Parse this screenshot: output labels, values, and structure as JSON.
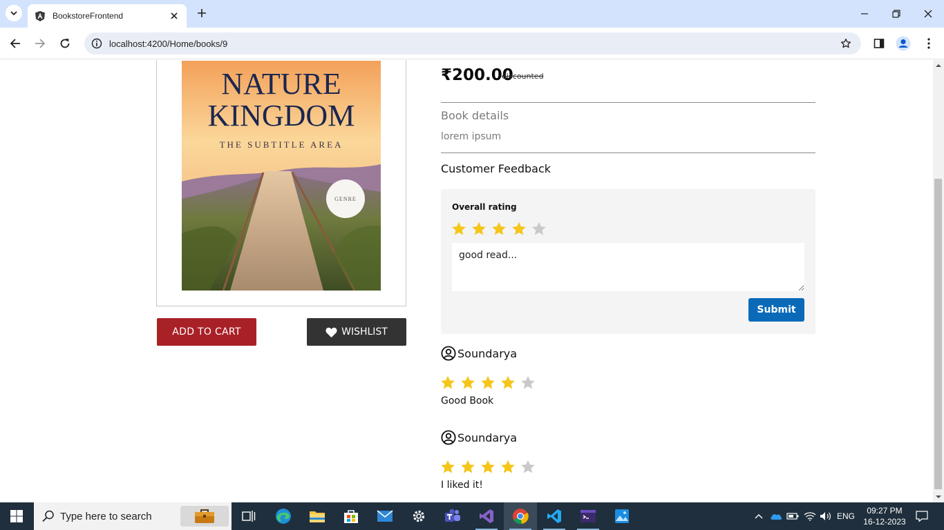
{
  "browser": {
    "tab_title": "BookstoreFrontend",
    "url": "localhost:4200/Home/books/9"
  },
  "book": {
    "cover": {
      "title_line1": "NATURE",
      "title_line2": "KINGDOM",
      "subtitle": "THE SUBTITLE AREA",
      "badge": "GENRE"
    },
    "price": "₹200.00",
    "price_note": "discounted",
    "details_heading": "Book details",
    "details_text": "lorem ipsum",
    "add_to_cart_label": "ADD TO CART",
    "wishlist_label": "WISHLIST"
  },
  "feedback": {
    "heading": "Customer Feedback",
    "overall_rating_label": "Overall rating",
    "rating": 4,
    "max_rating": 5,
    "comment_value": "good read...",
    "submit_label": "Submit"
  },
  "reviews": [
    {
      "user": "Soundarya",
      "rating": 4,
      "text": "Good Book"
    },
    {
      "user": "Soundarya",
      "rating": 4,
      "text": "I liked it!"
    }
  ],
  "colors": {
    "star_filled": "#f5c518",
    "star_empty": "#c9c9c9",
    "cart_button": "#a82127",
    "wishlist_button": "#333333",
    "submit_button": "#0a6ab8"
  },
  "taskbar": {
    "search_placeholder": "Type here to search",
    "language": "ENG",
    "time": "09:27 PM",
    "date": "16-12-2023",
    "pinned_apps": [
      "task-view-icon",
      "edge-icon",
      "file-explorer-icon",
      "store-icon",
      "mail-icon",
      "settings-icon",
      "teams-icon",
      "visual-studio-icon",
      "chrome-icon",
      "vscode-icon",
      "terminal-icon",
      "photos-icon"
    ]
  }
}
